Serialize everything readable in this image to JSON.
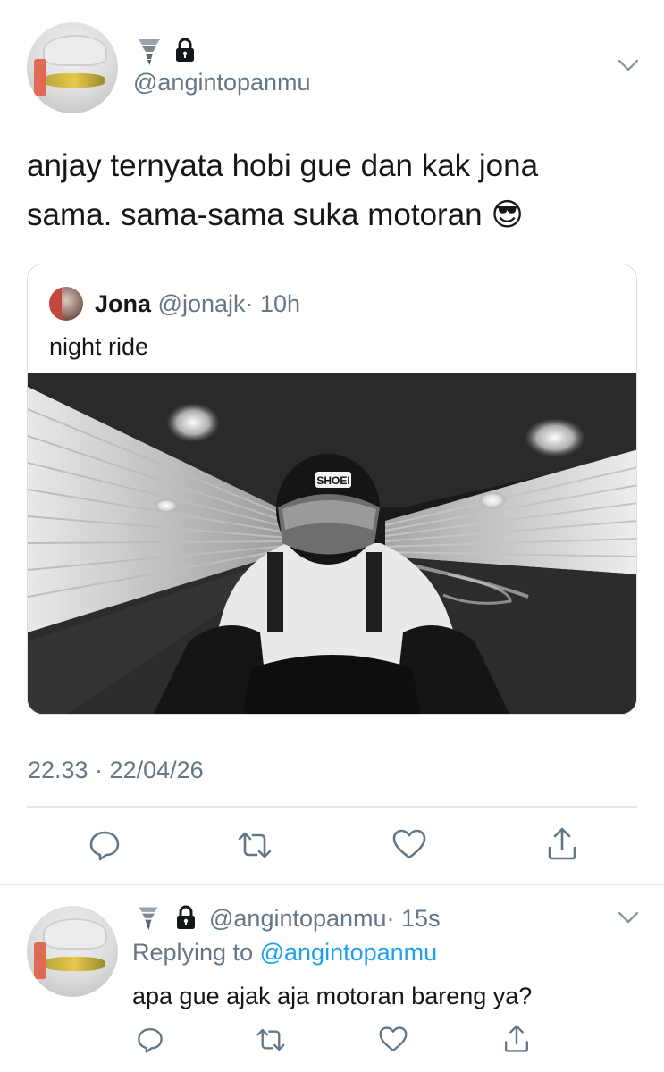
{
  "tweet": {
    "handle": "@angintopanmu",
    "text_line1": "anjay ternyata hobi gue dan kak jona",
    "text_line2": "sama. sama-sama suka motoran 😎",
    "timestamp": "22.33 · 22/04/26",
    "name_icons": [
      "tornado-icon",
      "lock-icon"
    ]
  },
  "quoted": {
    "name": "Jona",
    "handle": "@jonajk",
    "time": "· 10h",
    "text": "night ride",
    "photo_text": "SHOEI"
  },
  "actions": [
    "reply-icon",
    "retweet-icon",
    "like-icon",
    "share-icon"
  ],
  "reply": {
    "handle": "@angintopanmu",
    "time": "· 15s",
    "replying_prefix": "Replying to",
    "replying_to": "@angintopanmu",
    "text": "apa gue ajak aja motoran bareng ya?"
  },
  "colors": {
    "accent": "#1da1f2",
    "secondary_text": "#657786",
    "border": "#e1e8ed"
  }
}
